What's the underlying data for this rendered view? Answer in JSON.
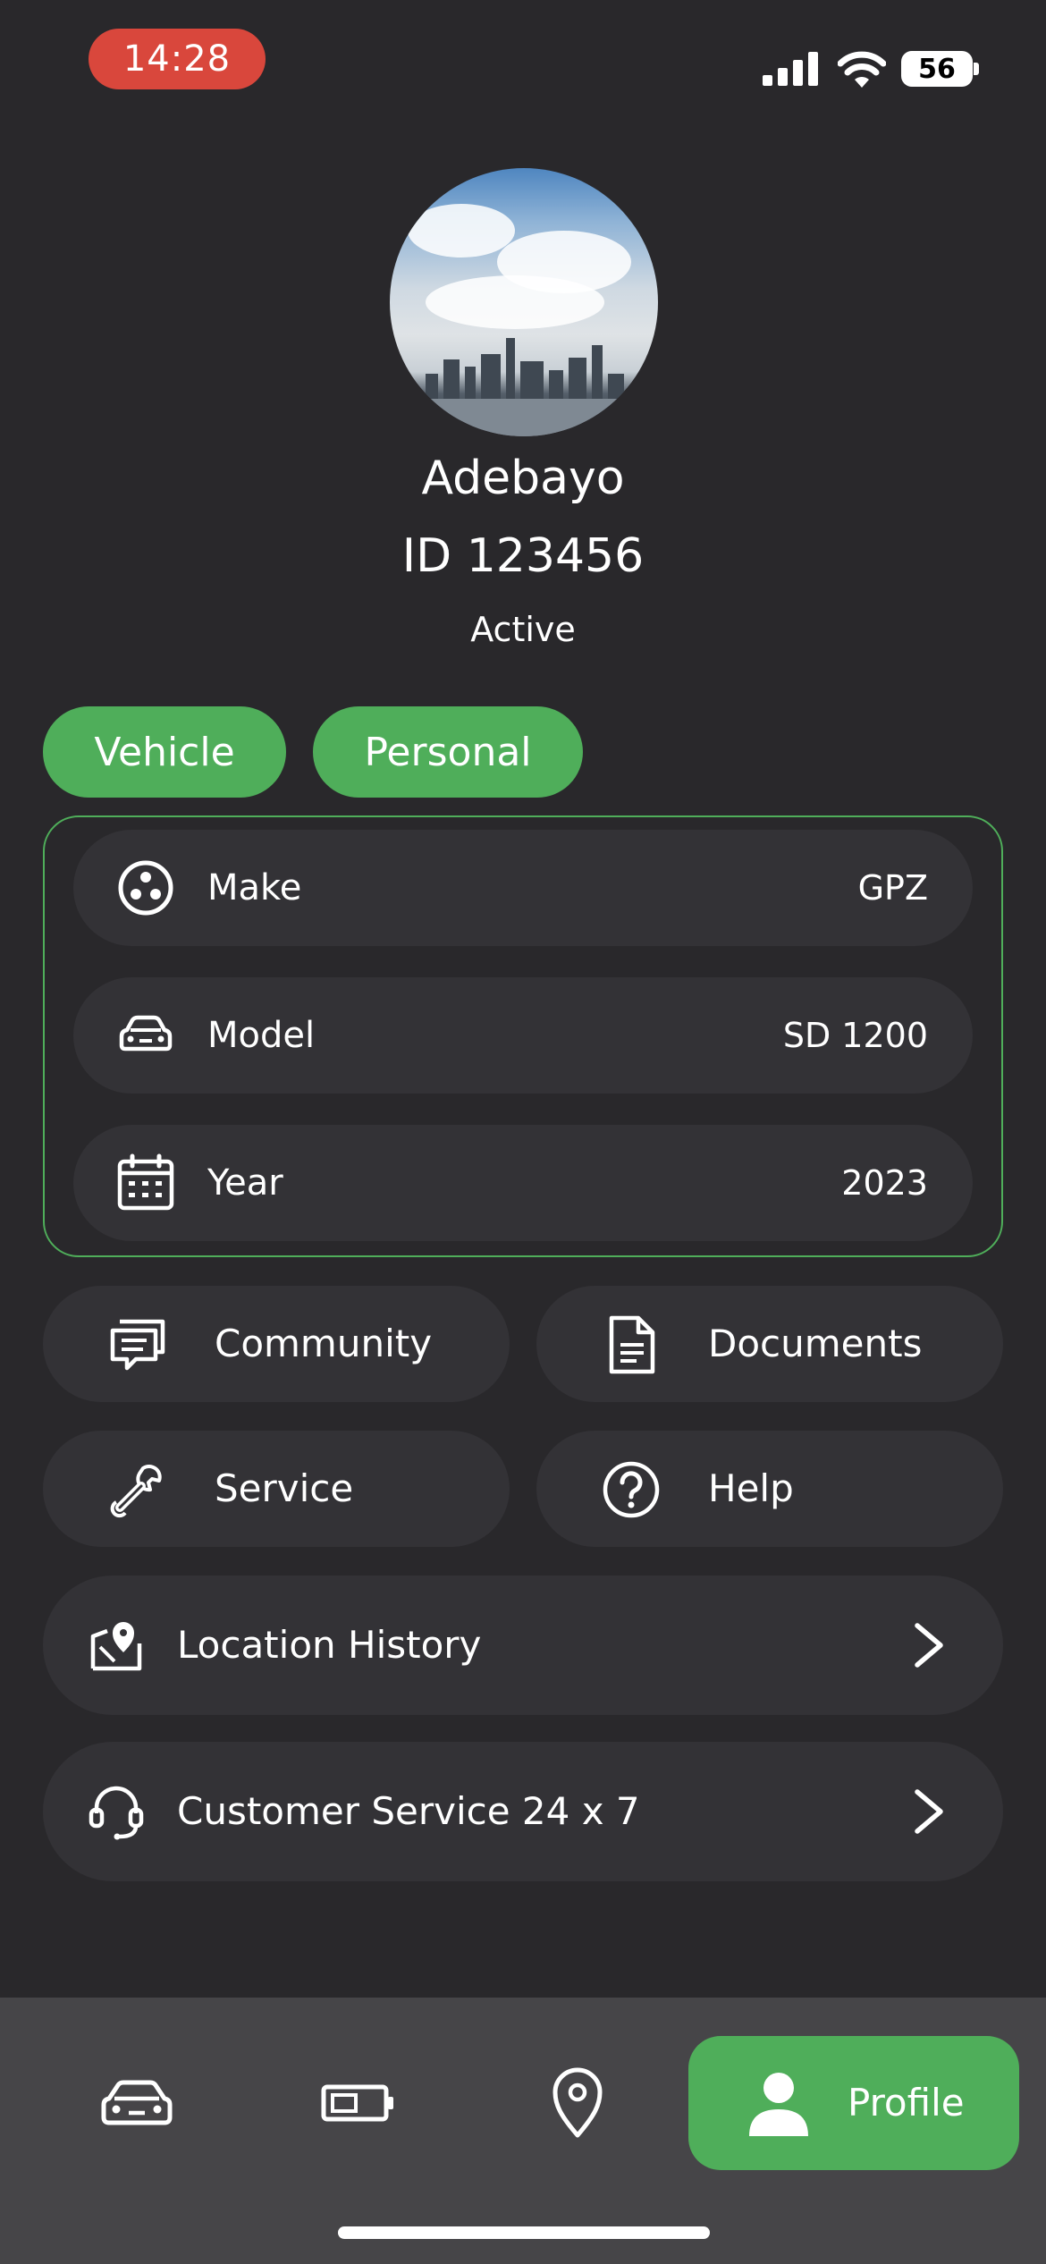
{
  "status_bar": {
    "time": "14:28",
    "battery": "56"
  },
  "profile": {
    "name": "Adebayo",
    "id": "ID 123456",
    "status": "Active"
  },
  "tabs": {
    "vehicle": "Vehicle",
    "personal": "Personal"
  },
  "vehicle": [
    {
      "icon": "three-dots-circle-icon",
      "label": "Make",
      "value": "GPZ"
    },
    {
      "icon": "car-icon",
      "label": "Model",
      "value": "SD 1200"
    },
    {
      "icon": "calendar-icon",
      "label": "Year",
      "value": "2023"
    }
  ],
  "actions": [
    {
      "icon": "chat-icon",
      "label": "Community"
    },
    {
      "icon": "document-icon",
      "label": "Documents"
    },
    {
      "icon": "wrench-icon",
      "label": "Service"
    },
    {
      "icon": "help-icon",
      "label": "Help"
    }
  ],
  "links": [
    {
      "icon": "map-pin-icon",
      "label": "Location History"
    },
    {
      "icon": "headset-icon",
      "label": "Customer Service 24 x 7"
    }
  ],
  "nav": {
    "profile_label": "Profile"
  },
  "colors": {
    "accent": "#4fae5a",
    "background": "#29282b",
    "card": "#333236",
    "time_pill": "#d9473c"
  }
}
